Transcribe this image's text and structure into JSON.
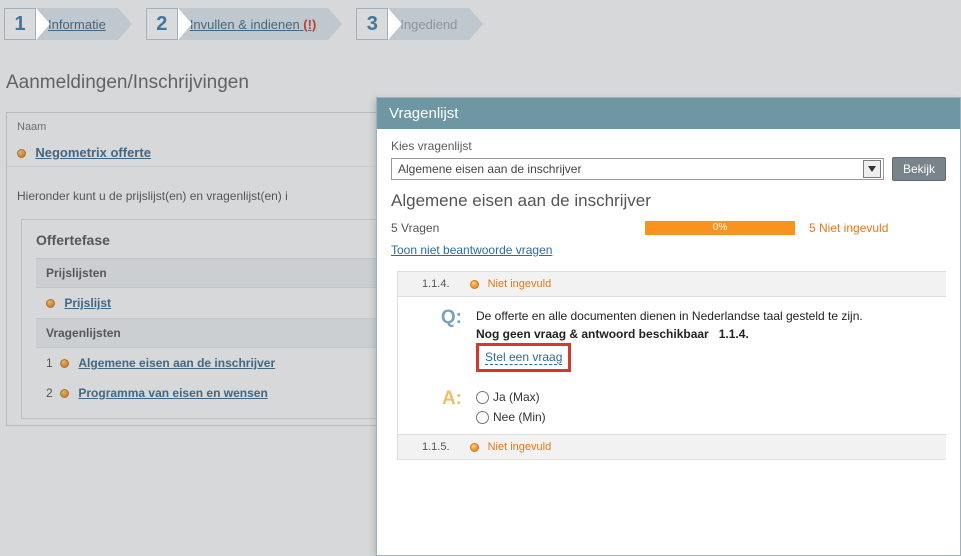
{
  "steps": [
    {
      "num": "1",
      "label": "Informatie"
    },
    {
      "num": "2",
      "label": "Invullen & indienen",
      "alert": "(!)"
    },
    {
      "num": "3",
      "label": "Ingediend"
    }
  ],
  "page_title": "Aanmeldingen/Inschrijvingen",
  "left": {
    "naam_header": "Naam",
    "offer_link": "Negometrix offerte",
    "intro": "Hieronder kunt u de prijslijst(en) en vragenlijst(en) i",
    "fase_title": "Offertefase",
    "prijs_header": "Prijslijsten",
    "prijs_link": "Prijslijst",
    "vragen_header": "Vragenlijsten",
    "vragen_items": [
      {
        "n": "1",
        "label": "Algemene eisen aan de inschrijver"
      },
      {
        "n": "2",
        "label": "Programma van eisen en wensen"
      }
    ]
  },
  "dialog": {
    "title": "Vragenlijst",
    "kies_label": "Kies vragenlijst",
    "selected": "Algemene eisen aan de inschrijver",
    "view_btn": "Bekijk",
    "list_title": "Algemene eisen aan de inschrijver",
    "count_label": "5 Vragen",
    "progress_pct": "0%",
    "remaining": "5 Niet ingevuld",
    "toon_link": "Toon niet beantwoorde vragen",
    "q1": {
      "num": "1.1.4.",
      "status": "Niet ingevuld",
      "q_text": "De offerte en alle documenten dienen in Nederlandse taal gesteld te zijn.",
      "sub": "Nog geen vraag & antwoord beschikbaar",
      "sub_code": "1.1.4.",
      "ask": "Stel een vraag",
      "opt_yes": "Ja (Max)",
      "opt_no": "Nee (Min)"
    },
    "q2": {
      "num": "1.1.5.",
      "status": "Niet ingevuld"
    }
  }
}
